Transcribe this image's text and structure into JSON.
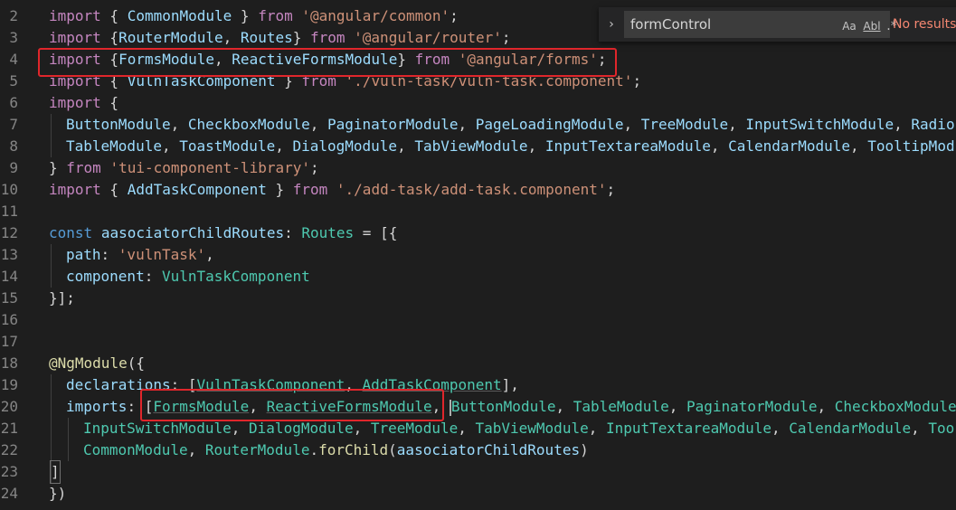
{
  "find_widget": {
    "query": "formControl",
    "toggle_glyph": "›",
    "match_case_label": "Aa",
    "whole_word_label": "Abl",
    "regex_label": ".*",
    "result_text": "No results"
  },
  "colors": {
    "background": "#1e1e1e",
    "keyword": "#569cd6",
    "control": "#c586c0",
    "type": "#4ec9b0",
    "string": "#ce9178",
    "variable": "#9cdcfe",
    "highlight_box": "#e0262b"
  },
  "lines": [
    {
      "n": "2"
    },
    {
      "n": "3"
    },
    {
      "n": "4"
    },
    {
      "n": "5"
    },
    {
      "n": "6"
    },
    {
      "n": "7"
    },
    {
      "n": "8"
    },
    {
      "n": "9"
    },
    {
      "n": "10"
    },
    {
      "n": "11"
    },
    {
      "n": "12"
    },
    {
      "n": "13"
    },
    {
      "n": "14"
    },
    {
      "n": "15"
    },
    {
      "n": "16"
    },
    {
      "n": "17"
    },
    {
      "n": "18"
    },
    {
      "n": "19"
    },
    {
      "n": "20"
    },
    {
      "n": "21"
    },
    {
      "n": "22"
    },
    {
      "n": "23"
    },
    {
      "n": "24"
    }
  ],
  "code": {
    "l2": [
      "import",
      " { ",
      "CommonModule",
      " } ",
      "from",
      " ",
      "'@angular/common'",
      ";"
    ],
    "l3": [
      "import",
      " {",
      "RouterModule",
      ", ",
      "Routes",
      "} ",
      "from",
      " ",
      "'@angular/router'",
      ";"
    ],
    "l4": [
      "import",
      " {",
      "FormsModule",
      ", ",
      "ReactiveFormsModule",
      "} ",
      "from",
      " ",
      "'@angular/forms'",
      ";"
    ],
    "l5": [
      "import",
      " { ",
      "VulnTaskComponent",
      " } ",
      "from",
      " ",
      "'./vuln-task/vuln-task.component'",
      ";"
    ],
    "l6": [
      "import",
      " {"
    ],
    "l7": [
      "ButtonModule",
      ", ",
      "CheckboxModule",
      ", ",
      "PaginatorModule",
      ", ",
      "PageLoadingModule",
      ", ",
      "TreeModule",
      ", ",
      "InputSwitchModule",
      ", ",
      "Radio"
    ],
    "l8": [
      "TableModule",
      ", ",
      "ToastModule",
      ", ",
      "DialogModule",
      ", ",
      "TabViewModule",
      ", ",
      "InputTextareaModule",
      ", ",
      "CalendarModule",
      ", ",
      "TooltipMod"
    ],
    "l9": [
      "} ",
      "from",
      " ",
      "'tui-component-library'",
      ";"
    ],
    "l10": [
      "import",
      " { ",
      "AddTaskComponent",
      " } ",
      "from",
      " ",
      "'./add-task/add-task.component'",
      ";"
    ],
    "l12": [
      "const",
      " ",
      "aasociatorChildRoutes",
      ": ",
      "Routes",
      " = [{"
    ],
    "l13": [
      "path",
      ": ",
      "'vulnTask'",
      ","
    ],
    "l14": [
      "component",
      ": ",
      "VulnTaskComponent"
    ],
    "l15": [
      "}];"
    ],
    "l18": [
      "@",
      "NgModule",
      "({"
    ],
    "l19": [
      "declarations",
      ": [",
      "VulnTaskComponent",
      ", ",
      "AddTaskComponent",
      "],"
    ],
    "l20": [
      "imports",
      ": ",
      "[",
      "FormsModule",
      ", ",
      "ReactiveFormsModule",
      ", ",
      "ButtonModule",
      ", ",
      "TableModule",
      ", ",
      "PaginatorModule",
      ", ",
      "CheckboxModule"
    ],
    "l21": [
      "InputSwitchModule",
      ", ",
      "DialogModule",
      ", ",
      "TreeModule",
      ", ",
      "TabViewModule",
      ", ",
      "InputTextareaModule",
      ", ",
      "CalendarModule",
      ", ",
      "Too"
    ],
    "l22": [
      "CommonModule",
      ", ",
      "RouterModule",
      ".",
      "forChild",
      "(",
      "aasociatorChildRoutes",
      ")"
    ],
    "l23": [
      "]"
    ],
    "l24": [
      "})"
    ]
  }
}
